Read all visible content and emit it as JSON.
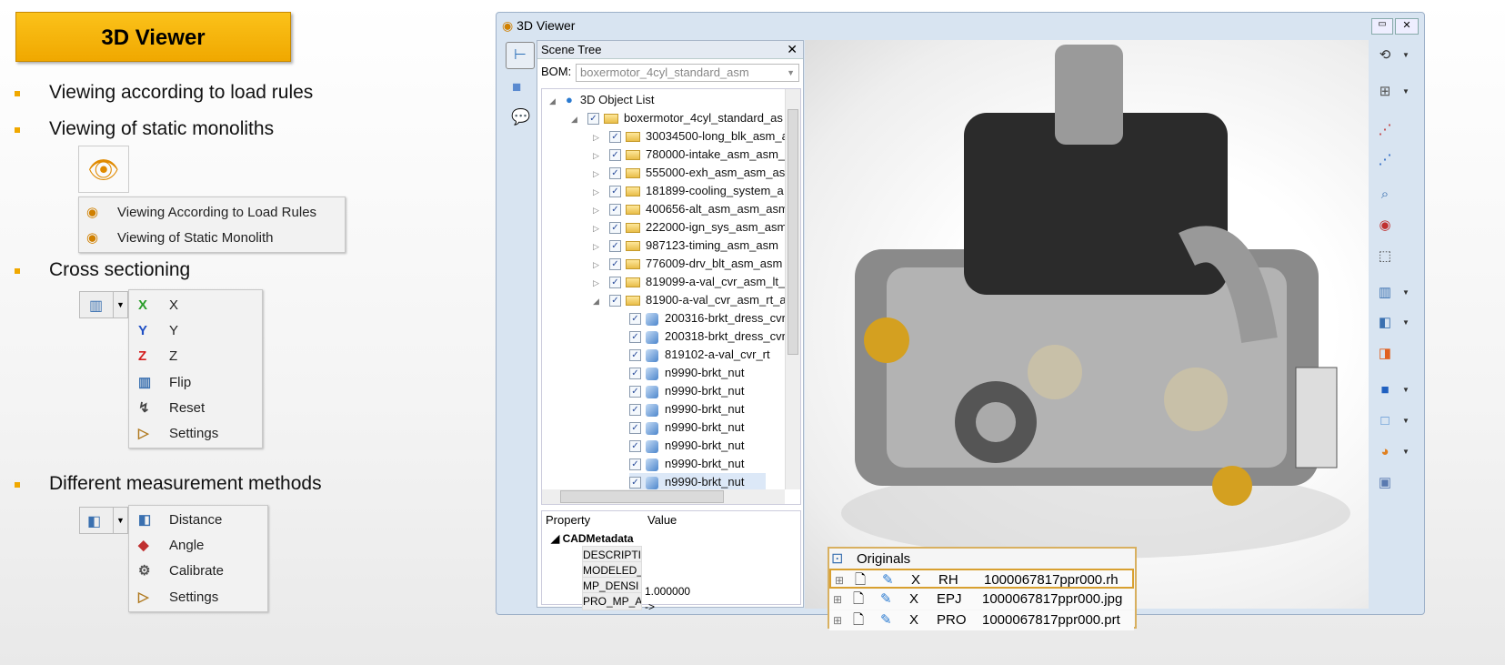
{
  "slide": {
    "title": "3D Viewer",
    "bullets": [
      "Viewing according to load rules",
      "Viewing of static monoliths",
      "Cross sectioning",
      "Different measurement methods"
    ],
    "view_menu": [
      "Viewing According to Load Rules",
      "Viewing of Static Monolith"
    ],
    "section_menu": [
      {
        "icon": "x-axis-icon",
        "label": "X",
        "glyph": "X",
        "color": "#2a9d2a"
      },
      {
        "icon": "y-axis-icon",
        "label": "Y",
        "glyph": "Y",
        "color": "#1f4fc4"
      },
      {
        "icon": "z-axis-icon",
        "label": "Z",
        "glyph": "Z",
        "color": "#d42020"
      },
      {
        "icon": "flip-icon",
        "label": "Flip",
        "glyph": "▥",
        "color": "#3a70b0"
      },
      {
        "icon": "reset-icon",
        "label": "Reset",
        "glyph": "↯",
        "color": "#444"
      },
      {
        "icon": "settings-triangle-icon",
        "label": "Settings",
        "glyph": "▷",
        "color": "#b07a20"
      }
    ],
    "measure_menu": [
      {
        "icon": "distance-icon",
        "label": "Distance",
        "glyph": "◧",
        "color": "#3a70b0"
      },
      {
        "icon": "angle-icon",
        "label": "Angle",
        "glyph": "◆",
        "color": "#c03030"
      },
      {
        "icon": "calibrate-icon",
        "label": "Calibrate",
        "glyph": "⚙",
        "color": "#555"
      },
      {
        "icon": "settings-triangle-icon",
        "label": "Settings",
        "glyph": "▷",
        "color": "#b07a20"
      }
    ]
  },
  "viewer": {
    "title": "3D Viewer",
    "scene_tree": {
      "header": "Scene Tree",
      "bom_label": "BOM:",
      "bom_value": "boxermotor_4cyl_standard_asm",
      "root": "3D Object List",
      "assembly": "boxermotor_4cyl_standard_as",
      "folders": [
        "30034500-long_blk_asm_a",
        "780000-intake_asm_asm_",
        "555000-exh_asm_asm_asr",
        "181899-cooling_system_a",
        "400656-alt_asm_asm_asm",
        "222000-ign_sys_asm_asm",
        "987123-timing_asm_asm",
        "776009-drv_blt_asm_asm",
        "819099-a-val_cvr_asm_lt_",
        "81900-a-val_cvr_asm_rt_a"
      ],
      "parts": [
        "200316-brkt_dress_cvr",
        "200318-brkt_dress_cvr",
        "819102-a-val_cvr_rt",
        "n9990-brkt_nut",
        "n9990-brkt_nut",
        "n9990-brkt_nut",
        "n9990-brkt_nut",
        "n9990-brkt_nut",
        "n9990-brkt_nut",
        "n9990-brkt_nut"
      ]
    },
    "properties": {
      "col_property": "Property",
      "col_value": "Value",
      "group": "CADMetadata",
      "rows": [
        {
          "k": "DESCRIPTI",
          "v": ""
        },
        {
          "k": "MODELED_",
          "v": ""
        },
        {
          "k": "MP_DENSI",
          "v": "1.000000"
        },
        {
          "k": "PRO_MP_A",
          "v": "->"
        }
      ]
    },
    "originals": {
      "title": "Originals",
      "rows": [
        {
          "x": "X",
          "type": "RH",
          "file": "1000067817ppr000.rh"
        },
        {
          "x": "X",
          "type": "EPJ",
          "file": "1000067817ppr000.jpg"
        },
        {
          "x": "X",
          "type": "PRO",
          "file": "1000067817ppr000.prt"
        }
      ]
    },
    "toolbar": [
      {
        "icon": "rotate-icon",
        "glyph": "⟲",
        "color": "#333"
      },
      {
        "icon": "layout-icon",
        "glyph": "⊞",
        "color": "#555"
      },
      {
        "icon": "measure-icon",
        "glyph": "⋰",
        "color": "#c03030"
      },
      {
        "icon": "measure-alt-icon",
        "glyph": "⋰",
        "color": "#2060c0"
      },
      {
        "icon": "zoom-fit-icon",
        "glyph": "⌕",
        "color": "#3a70b0"
      },
      {
        "icon": "color-icon",
        "glyph": "◉",
        "color": "#c03030"
      },
      {
        "icon": "select-icon",
        "glyph": "⬚",
        "color": "#444"
      },
      {
        "icon": "section-icon",
        "glyph": "▥",
        "color": "#3a70b0"
      },
      {
        "icon": "distance-icon",
        "glyph": "◧",
        "color": "#3a70b0"
      },
      {
        "icon": "transparency-icon",
        "glyph": "◨",
        "color": "#e06020"
      },
      {
        "icon": "shaded-cube-icon",
        "glyph": "■",
        "color": "#2060c0"
      },
      {
        "icon": "wire-cube-icon",
        "glyph": "□",
        "color": "#4a8ad0"
      },
      {
        "icon": "shapes-icon",
        "glyph": "◕",
        "color": "#e08020"
      },
      {
        "icon": "frame-icon",
        "glyph": "▣",
        "color": "#5a7ab0"
      }
    ]
  }
}
